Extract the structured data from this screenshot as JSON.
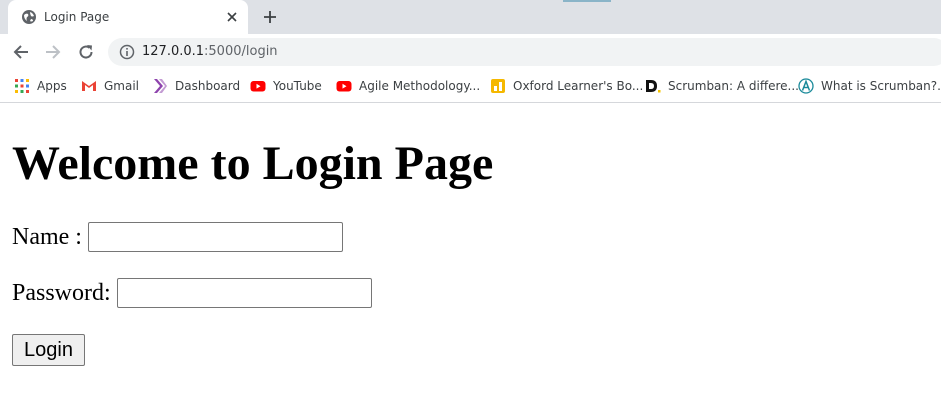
{
  "browser": {
    "tab": {
      "title": "Login Page"
    },
    "address_bar": {
      "host": "127.0.0.1",
      "port_path": ":5000/login"
    },
    "bookmarks": [
      {
        "label": "Apps",
        "icon": "apps-grid-icon"
      },
      {
        "label": "Gmail",
        "icon": "gmail-icon"
      },
      {
        "label": "Dashboard",
        "icon": "dashboard-icon"
      },
      {
        "label": "YouTube",
        "icon": "youtube-icon"
      },
      {
        "label": "Agile Methodology...",
        "icon": "youtube-icon"
      },
      {
        "label": "Oxford Learner's Bo...",
        "icon": "oxford-icon"
      },
      {
        "label": "Scrumban: A differe...",
        "icon": "d-logo-icon"
      },
      {
        "label": "What is Scrumban?...",
        "icon": "a-logo-icon"
      }
    ]
  },
  "page": {
    "heading": "Welcome to Login Page",
    "name_label": "Name :",
    "name_value": "",
    "password_label": "Password:",
    "password_value": "",
    "login_button": "Login"
  },
  "colors": {
    "tabstrip_bg": "#dee1e6",
    "omnibox_bg": "#f1f3f4",
    "youtube_red": "#ff0000",
    "gmail_red": "#ea4335"
  }
}
